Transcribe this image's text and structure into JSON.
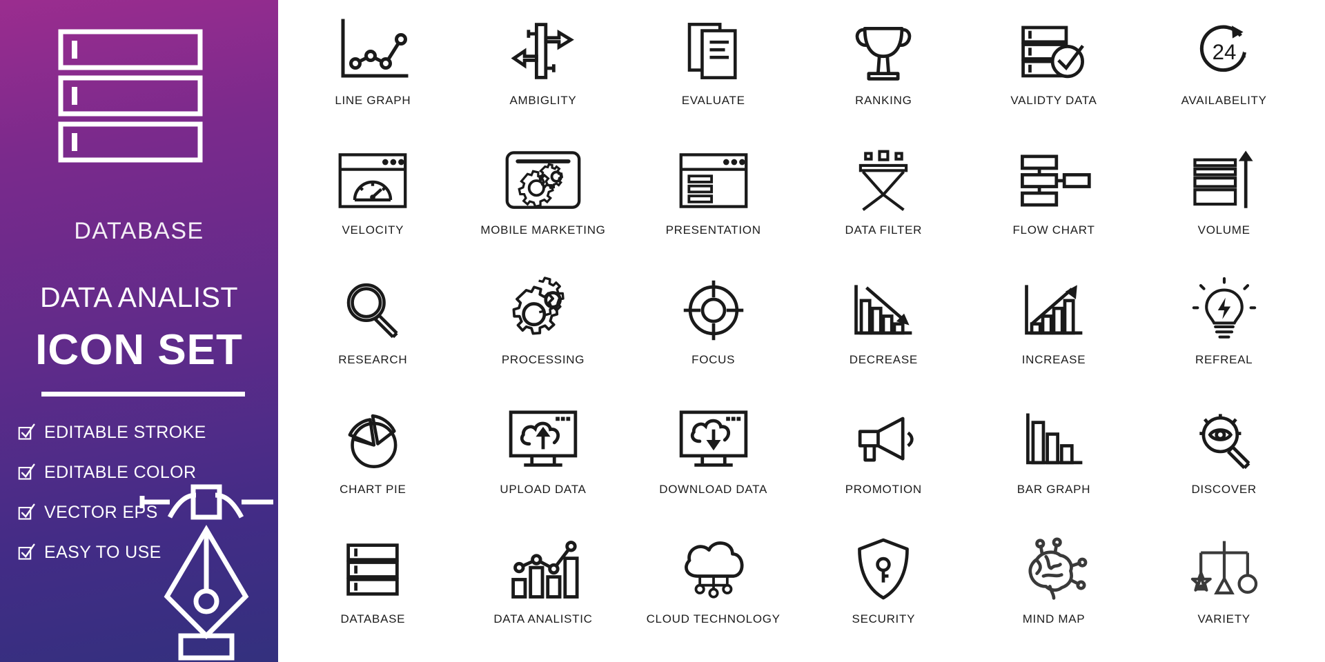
{
  "sidebar": {
    "logo_icon": "database-stack-icon",
    "title": "DATABASE",
    "subtitle": "DATA ANALIST",
    "headline": "ICON SET",
    "features": [
      {
        "icon": "checkbox-checked-icon",
        "label": "EDITABLE STROKE"
      },
      {
        "icon": "checkbox-checked-icon",
        "label": "EDITABLE COLOR"
      },
      {
        "icon": "checkbox-checked-icon",
        "label": "VECTOR EPS"
      },
      {
        "icon": "checkbox-checked-icon",
        "label": "EASY TO USE"
      }
    ],
    "decoration_icon": "pen-nib-bezier-icon",
    "colors": {
      "gradient_start": "#9b2d8f",
      "gradient_mid": "#5f2b8a",
      "gradient_end": "#33307e",
      "text": "#ffffff"
    }
  },
  "grid": {
    "columns": 6,
    "rows": 5,
    "stroke_color": "#1a1a1a",
    "background": "#ffffff",
    "icons": [
      {
        "icon": "line-graph-icon",
        "label": "LINE GRAPH"
      },
      {
        "icon": "ambiguity-arrows-icon",
        "label": "AMBIGLITY"
      },
      {
        "icon": "evaluate-documents-icon",
        "label": "EVALUATE"
      },
      {
        "icon": "ranking-trophy-icon",
        "label": "RANKING"
      },
      {
        "icon": "validity-data-check-icon",
        "label": "VALIDTY DATA"
      },
      {
        "icon": "availability-24h-icon",
        "label": "AVAILABELITY"
      },
      {
        "icon": "velocity-speedometer-browser-icon",
        "label": "VELOCITY"
      },
      {
        "icon": "mobile-marketing-gears-icon",
        "label": "MOBILE MARKETING"
      },
      {
        "icon": "presentation-browser-icon",
        "label": "PRESENTATION"
      },
      {
        "icon": "data-filter-funnel-icon",
        "label": "DATA FILTER"
      },
      {
        "icon": "flow-chart-icon",
        "label": "FLOW CHART"
      },
      {
        "icon": "volume-layers-arrow-icon",
        "label": "VOLUME"
      },
      {
        "icon": "research-magnifier-icon",
        "label": "RESEARCH"
      },
      {
        "icon": "processing-gears-icon",
        "label": "PROCESSING"
      },
      {
        "icon": "focus-target-icon",
        "label": "FOCUS"
      },
      {
        "icon": "decrease-chart-icon",
        "label": "DECREASE"
      },
      {
        "icon": "increase-chart-icon",
        "label": "INCREASE"
      },
      {
        "icon": "refreal-lightbulb-icon",
        "label": "REFREAL"
      },
      {
        "icon": "chart-pie-icon",
        "label": "CHART PIE"
      },
      {
        "icon": "upload-data-cloud-icon",
        "label": "UPLOAD DATA"
      },
      {
        "icon": "download-data-cloud-icon",
        "label": "DOWNLOAD DATA"
      },
      {
        "icon": "promotion-megaphone-icon",
        "label": "PROMOTION"
      },
      {
        "icon": "bar-graph-icon",
        "label": "BAR GRAPH"
      },
      {
        "icon": "discover-magnifier-eye-icon",
        "label": "DISCOVER"
      },
      {
        "icon": "database-stack-icon",
        "label": "DATABASE"
      },
      {
        "icon": "data-analistic-icon",
        "label": "DATA ANALISTIC"
      },
      {
        "icon": "cloud-technology-icon",
        "label": "CLOUD TECHNOLOGY"
      },
      {
        "icon": "security-shield-key-icon",
        "label": "SECURITY"
      },
      {
        "icon": "mind-map-brain-icon",
        "label": "MIND MAP"
      },
      {
        "icon": "variety-shapes-icon",
        "label": "VARIETY"
      }
    ]
  }
}
